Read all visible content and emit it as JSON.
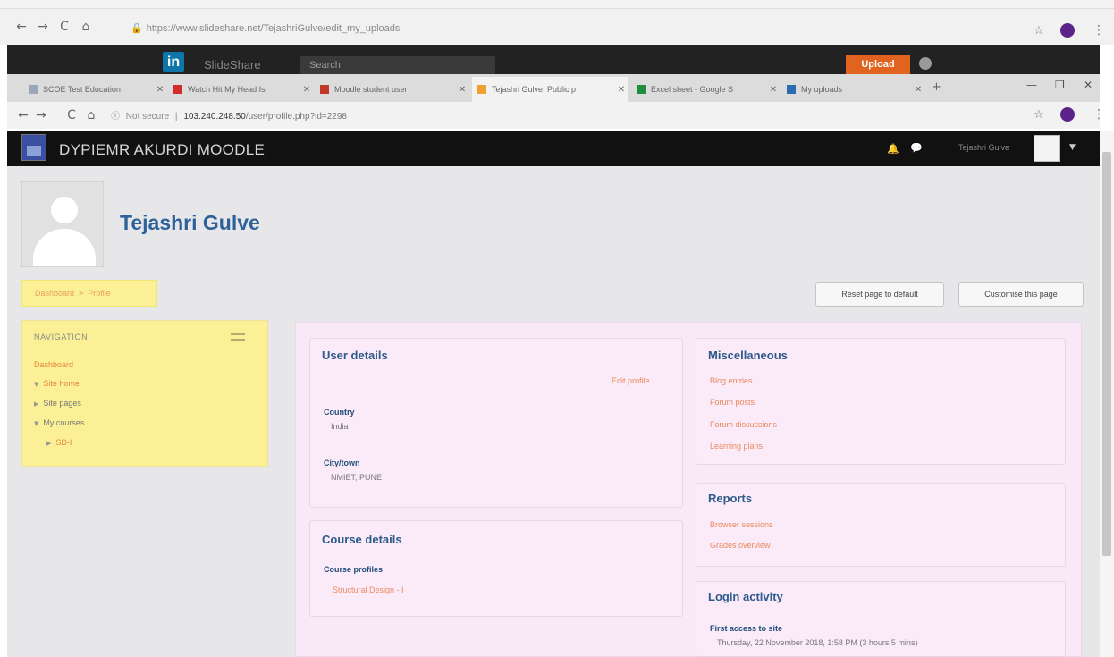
{
  "outer_browser": {
    "url": "https://www.slideshare.net/TejashriGulve/edit_my_uploads"
  },
  "slideshare": {
    "logo_text": "in",
    "brand": "SlideShare",
    "search_placeholder": "Search",
    "upload_label": "Upload"
  },
  "inner_browser": {
    "tabs": [
      {
        "title": "SCOE Test Education",
        "favicon_color": "#9aa7b8"
      },
      {
        "title": "Watch Hit My Head Is",
        "favicon_color": "#d22c2c"
      },
      {
        "title": "Moodle student user",
        "favicon_color": "#c0392b"
      },
      {
        "title": "Tejashri Gulve: Public p",
        "favicon_color": "#f0a030"
      },
      {
        "title": "Excel sheet - Google S",
        "favicon_color": "#1e8e3e"
      },
      {
        "title": "My uploads",
        "favicon_color": "#2b6cb0"
      }
    ],
    "security_label": "Not secure",
    "url_host": "103.240.248.50",
    "url_path": "/user/profile.php?id=2298"
  },
  "moodle": {
    "site_name": "DYPIEMR AKURDI MOODLE",
    "user_menu_name": "Tejashri Gulve",
    "fullname": "Tejashri Gulve",
    "breadcrumb": [
      "Dashboard",
      "Profile"
    ],
    "reset_button": "Reset page to default",
    "customise_button": "Customise this page",
    "navigation": {
      "title": "NAVIGATION",
      "dashboard": "Dashboard",
      "site_home": "Site home",
      "site_pages": "Site pages",
      "my_courses": "My courses",
      "course": "SD-I"
    },
    "user_details": {
      "title": "User details",
      "edit_profile": "Edit profile",
      "country_label": "Country",
      "country_value": "India",
      "city_label": "City/town",
      "city_value": "NMIET, PUNE"
    },
    "course_details": {
      "title": "Course details",
      "profiles_label": "Course profiles",
      "course_link": "Structural Design - I"
    },
    "miscellaneous": {
      "title": "Miscellaneous",
      "links": [
        "Blog entries",
        "Forum posts",
        "Forum discussions",
        "Learning plans"
      ]
    },
    "reports": {
      "title": "Reports",
      "links": [
        "Browser sessions",
        "Grades overview"
      ]
    },
    "login_activity": {
      "title": "Login activity",
      "first_access_label": "First access to site",
      "first_access_value": "Thursday, 22 November 2018, 1:58 PM  (3 hours 5 mins)"
    }
  },
  "colors": {
    "moodle_nav": "#111111",
    "block_yellow": "#fbf095",
    "main_pink": "#f9e8f6",
    "heading_blue": "#2d6199",
    "link_orange": "#e5863d"
  }
}
